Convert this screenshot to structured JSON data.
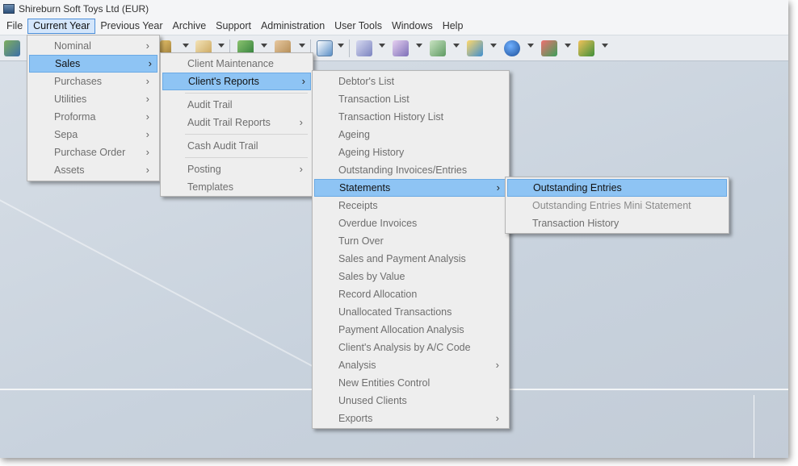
{
  "window": {
    "title": "Shireburn Soft Toys Ltd (EUR)"
  },
  "menubar": {
    "items": [
      {
        "label": "File"
      },
      {
        "label": "Current Year",
        "active": true
      },
      {
        "label": "Previous Year"
      },
      {
        "label": "Archive"
      },
      {
        "label": "Support"
      },
      {
        "label": "Administration"
      },
      {
        "label": "User Tools"
      },
      {
        "label": "Windows"
      },
      {
        "label": "Help"
      }
    ]
  },
  "toolbar": {
    "icons": [
      "stack-icon",
      "chart-icon",
      "document-icon",
      "user-icon",
      "user-dollar-icon",
      "import-icon",
      "database-icon",
      "person-badge-icon",
      "printer-icon",
      "people-icon",
      "euro-icon",
      "transfer-icon",
      "group-icon"
    ]
  },
  "current_year_menu": {
    "items": [
      {
        "label": "Nominal",
        "submenu": true
      },
      {
        "label": "Sales",
        "submenu": true,
        "highlighted": true
      },
      {
        "label": "Purchases",
        "submenu": true
      },
      {
        "label": "Utilities",
        "submenu": true
      },
      {
        "label": "Proforma",
        "submenu": true
      },
      {
        "label": "Sepa",
        "submenu": true
      },
      {
        "label": "Purchase Order",
        "submenu": true
      },
      {
        "label": "Assets",
        "submenu": true
      }
    ]
  },
  "sales_menu": {
    "items": [
      {
        "label": "Client Maintenance"
      },
      {
        "label": "Client's Reports",
        "submenu": true,
        "highlighted": true
      },
      {
        "label": "Audit Trail"
      },
      {
        "label": "Audit Trail Reports",
        "submenu": true
      },
      {
        "label": "Cash Audit Trail"
      },
      {
        "label": "Posting",
        "submenu": true
      },
      {
        "label": "Templates"
      }
    ]
  },
  "clients_reports_menu": {
    "items": [
      {
        "label": "Debtor's List"
      },
      {
        "label": "Transaction List"
      },
      {
        "label": "Transaction History List"
      },
      {
        "label": "Ageing"
      },
      {
        "label": "Ageing History"
      },
      {
        "label": "Outstanding Invoices/Entries"
      },
      {
        "label": "Statements",
        "submenu": true,
        "highlighted": true
      },
      {
        "label": "Receipts"
      },
      {
        "label": "Overdue Invoices"
      },
      {
        "label": "Turn Over"
      },
      {
        "label": "Sales and Payment Analysis"
      },
      {
        "label": "Sales by Value"
      },
      {
        "label": "Record Allocation"
      },
      {
        "label": "Unallocated Transactions"
      },
      {
        "label": "Payment Allocation Analysis"
      },
      {
        "label": "Client's Analysis by A/C Code"
      },
      {
        "label": "Analysis",
        "submenu": true
      },
      {
        "label": "New Entities Control"
      },
      {
        "label": "Unused Clients"
      },
      {
        "label": "Exports",
        "submenu": true
      }
    ]
  },
  "statements_menu": {
    "items": [
      {
        "label": "Outstanding Entries",
        "highlighted": true
      },
      {
        "label": "Outstanding Entries Mini Statement"
      },
      {
        "label": "Transaction History"
      }
    ]
  },
  "colors": {
    "highlight": "#8ec4f4",
    "menu_bg": "#eeeeee",
    "workspace": "#c8d2dd"
  }
}
